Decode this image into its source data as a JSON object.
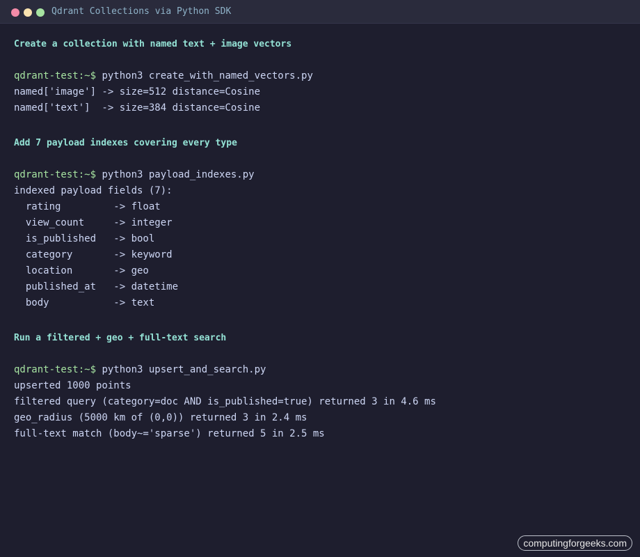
{
  "window": {
    "title": "Qdrant Collections via Python SDK",
    "controls": [
      "close-dot",
      "minimize-dot",
      "maximize-dot"
    ]
  },
  "colors": {
    "background": "#1e1e2e",
    "titlebar": "#2a2b3c",
    "heading": "#94e2d5",
    "prompt": "#a6e3a1",
    "text": "#cdd6f4"
  },
  "sections": [
    {
      "heading": "Create a collection with named text + image vectors",
      "prompt": "qdrant-test:~$",
      "command": " python3 create_with_named_vectors.py",
      "output": [
        "named['image'] -> size=512 distance=Cosine",
        "named['text']  -> size=384 distance=Cosine"
      ]
    },
    {
      "heading": "Add 7 payload indexes covering every type",
      "prompt": "qdrant-test:~$",
      "command": " python3 payload_indexes.py",
      "output": [
        "indexed payload fields (7):",
        "  rating         -> float",
        "  view_count     -> integer",
        "  is_published   -> bool",
        "  category       -> keyword",
        "  location       -> geo",
        "  published_at   -> datetime",
        "  body           -> text"
      ]
    },
    {
      "heading": "Run a filtered + geo + full-text search",
      "prompt": "qdrant-test:~$",
      "command": " python3 upsert_and_search.py",
      "output": [
        "upserted 1000 points",
        "filtered query (category=doc AND is_published=true) returned 3 in 4.6 ms",
        "geo_radius (5000 km of (0,0)) returned 3 in 2.4 ms",
        "full-text match (body~='sparse') returned 5 in 2.5 ms"
      ]
    }
  ],
  "watermark": "computingforgeeks.com"
}
